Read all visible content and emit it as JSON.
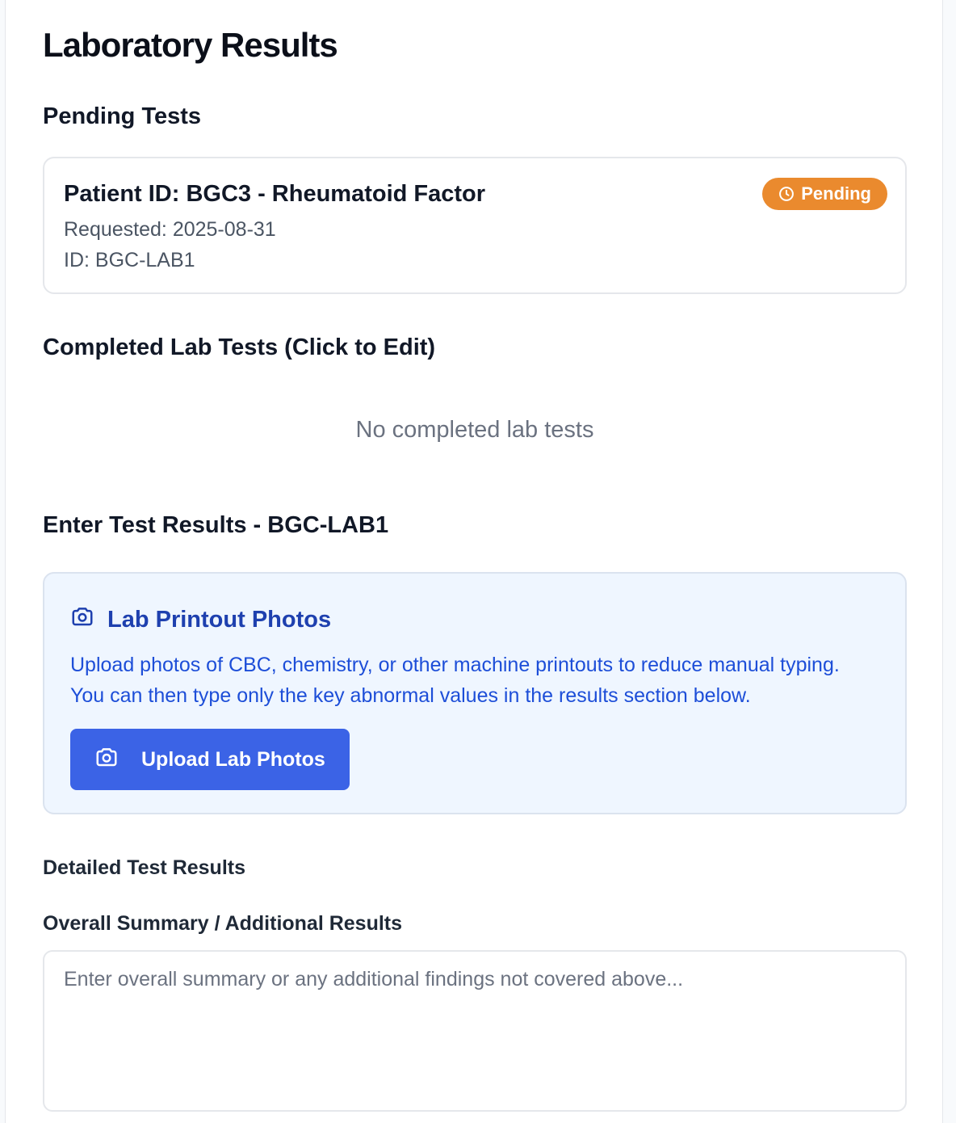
{
  "page": {
    "title": "Laboratory Results"
  },
  "pending": {
    "heading": "Pending Tests",
    "items": [
      {
        "title": "Patient ID: BGC3 - Rheumatoid Factor",
        "requested": "Requested: 2025-08-31",
        "id_line": "ID: BGC-LAB1",
        "status": "Pending",
        "status_icon": "clock-icon",
        "status_color": "#ea8a2e"
      }
    ]
  },
  "completed": {
    "heading": "Completed Lab Tests (Click to Edit)",
    "empty_text": "No completed lab tests"
  },
  "entry": {
    "heading": "Enter Test Results - BGC-LAB1",
    "photos": {
      "icon": "camera-icon",
      "title": "Lab Printout Photos",
      "description": "Upload photos of CBC, chemistry, or other machine printouts to reduce manual typing. You can then type only the key abnormal values in the results section below.",
      "button_label": "Upload Lab Photos",
      "button_color": "#3b63e6"
    },
    "detailed_label": "Detailed Test Results",
    "summary_label": "Overall Summary / Additional Results",
    "summary_value": "",
    "summary_placeholder": "Enter overall summary or any additional findings not covered above..."
  }
}
